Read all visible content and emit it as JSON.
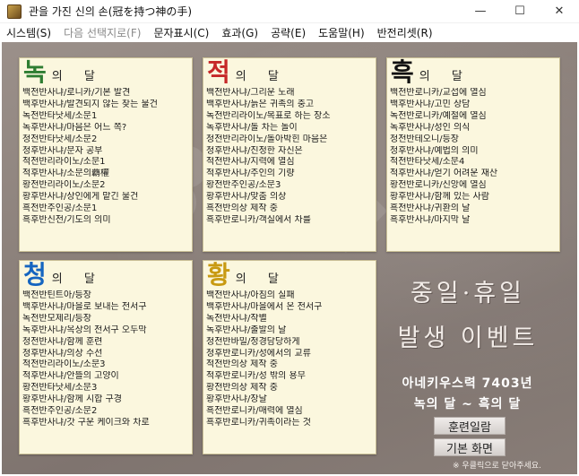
{
  "window": {
    "title": "관을 가진 신의 손(冠を持つ神の手)",
    "minimize_glyph": "—",
    "maximize_glyph": "☐",
    "close_glyph": "✕"
  },
  "menu": [
    {
      "label": "시스템(S)",
      "enabled": true
    },
    {
      "label": "다음 선택지로(F)",
      "enabled": false
    },
    {
      "label": "문자표시(C)",
      "enabled": true
    },
    {
      "label": "효과(G)",
      "enabled": true
    },
    {
      "label": "공략(E)",
      "enabled": true
    },
    {
      "label": "도움말(H)",
      "enabled": true
    },
    {
      "label": "반전리셋(R)",
      "enabled": true
    }
  ],
  "panels": {
    "green": {
      "big_char": "녹",
      "small_chars": "의 달",
      "color": "#2e7d32",
      "entries": [
        "백전반사냐/로니카/기본 발견",
        "백후반사냐/발견되지 않는 찾는 물건",
        "녹전반타낫세/소문1",
        "녹후반사냐/마음은 어느 쪽?",
        "청전반타낫세/소문2",
        "청후반사냐/문자 공부",
        "적전반리라이노/소문1",
        "적후반사냐/소문의覇權",
        "황전반리라이노/소문2",
        "황후반사냐/상인에게 맡긴 물건",
        "흑전반주인공/소문1",
        "흑후반신전/기도의 의미"
      ]
    },
    "red": {
      "big_char": "적",
      "small_chars": "의 달",
      "color": "#c62828",
      "entries": [
        "백전반사냐/그리운 노래",
        "백후반사냐/늙은 귀족의 충고",
        "녹전반리라이노/목표로 하는 장소",
        "녹후반사냐/돌 차는 놀이",
        "청전반리라이노/돌아박힌 마음은",
        "청후반사냐/진정한 자신은",
        "적전반사냐/지력에 열심",
        "적후반사냐/주인의 기량",
        "황전반주인공/소문3",
        "황후반사냐/맞춤 의상",
        "흑전반의상 제작 중",
        "흑후반로니카/객실에서 차를"
      ]
    },
    "black": {
      "big_char": "흑",
      "small_chars": "의 달",
      "color": "#111111",
      "entries": [
        "백전반로니카/교섭에 열심",
        "백후반사냐/고민 상담",
        "녹전반로니카/예절에 열심",
        "녹후반사냐/성인 의식",
        "청전반테오니/등장",
        "청후반사냐/예법의 의미",
        "적전반타낫세/소문4",
        "적후반사냐/얻기 어려운 재산",
        "황전반로니카/신앙에 열심",
        "황후반사냐/함께 있는 사람",
        "흑전반사냐/귀환의 날",
        "흑후반사냐/마지막 날"
      ]
    },
    "blue": {
      "big_char": "청",
      "small_chars": "의 달",
      "color": "#1565c0",
      "entries": [
        "백전반틴트아/등장",
        "백후반사냐/마을로 보내는 전서구",
        "녹전반모제리/등장",
        "녹후반사냐/옥상의 전서구 오두막",
        "청전반사냐/함께 훈련",
        "청후반사냐/의상 수선",
        "적전반리라이노/소문3",
        "적후반사냐/안뜰의 고양이",
        "황전반타낫세/소문3",
        "황후반사냐/함께 시합 구경",
        "흑전반주인공/소문2",
        "흑후반사냐/갓 구운 케이크와 차로"
      ]
    },
    "yellow": {
      "big_char": "황",
      "small_chars": "의 달",
      "color": "#c89a12",
      "entries": [
        "백전반사냐/아침의 실패",
        "백후반사냐/마을에서 온 전서구",
        "녹전반사냐/작별",
        "녹후반사냐/출발의 날",
        "청전반바밀/정경담당하게",
        "청후반로니카/성에서의 교류",
        "적전반의상 제작 중",
        "적후반로니카/성 밖의 용무",
        "황전반의상 제작 중",
        "황후반사냐/장날",
        "흑전반로니카/매력에 열심",
        "흑후반로니카/귀족이라는 것"
      ]
    }
  },
  "promo": {
    "line1": "중일·휴일",
    "line2": "발생 이벤트",
    "range_line1": "아네키우스력 7403년",
    "range_line2": "녹의 달 ~ 흑의 달",
    "training_button": "훈련일람",
    "main_button": "기본 화면",
    "hint": "※ 우클릭으로 닫아주세요."
  }
}
